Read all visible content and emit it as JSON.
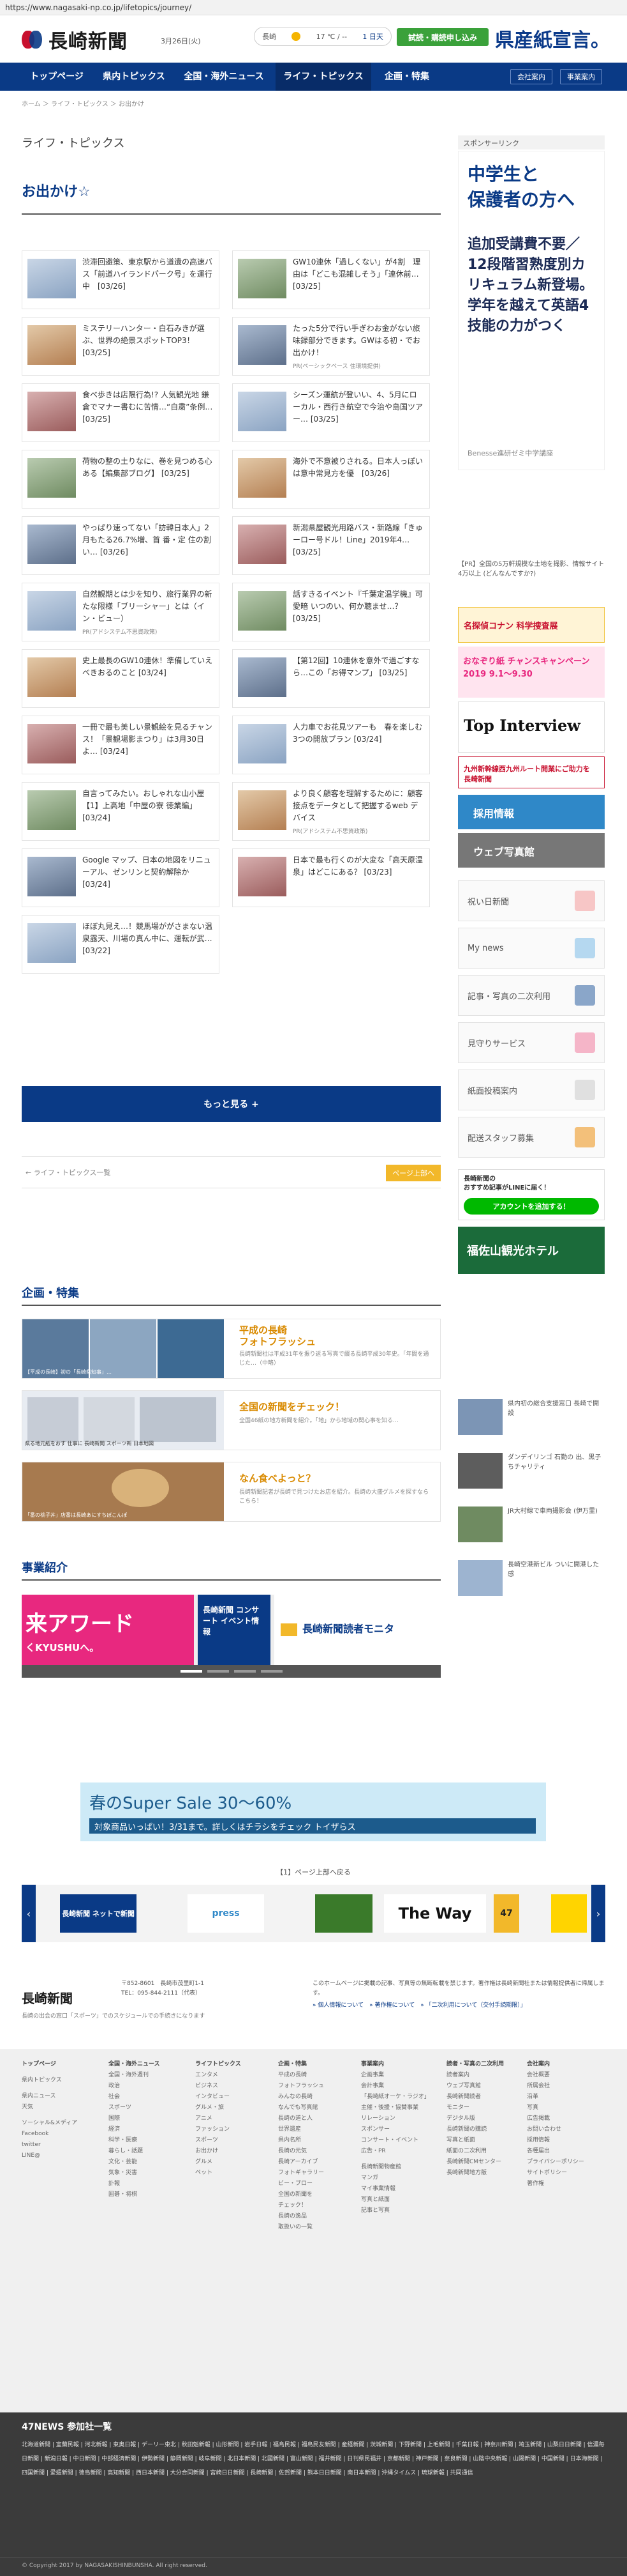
{
  "url": "https://www.nagasaki-np.co.jp/lifetopics/journey/",
  "header": {
    "logo": "長崎新聞",
    "date": "3月26日(火)",
    "weather": {
      "city": "長崎",
      "temp": "17 ℃ / --",
      "link": "1 日天"
    },
    "trial": "試読・購読申し込み",
    "ad_text": "県産紙宣言。"
  },
  "nav": {
    "items": [
      "トップページ",
      "県内トピックス",
      "全国・海外ニュース",
      "ライフ・トピックス",
      "企画・特集"
    ],
    "right": [
      "会社案内",
      "事業案内"
    ]
  },
  "breadcrumb": "ホーム ＞ ライフ・トピックス ＞ お出かけ",
  "section_title": "ライフ・トピックス",
  "page_title": "お出かけ☆",
  "articles": [
    {
      "title": "渋滞回避策、東京駅から道遺の高速バス「前道ハイランドパーク号」を運行中　[03/26]",
      "pr": ""
    },
    {
      "title": "GW10連休「過しくない」が4割　理由は「どこも混雑しそう」「連休前… [03/25]",
      "pr": ""
    },
    {
      "title": "ミステリーハンター・白石みきが選ぶ、世界の絶景スポットTOP3！ [03/25]",
      "pr": ""
    },
    {
      "title": "たった5分で行い手ぎわお金がない旅味録部分できます。GWはる初・でお出かけ！",
      "pr": "PR(ベーシックベース 住環境提供)"
    },
    {
      "title": "食べ歩きは店限行為!? 人気観光地 鎌倉でマナー書むに苦情…“自粛”条例… [03/25]",
      "pr": ""
    },
    {
      "title": "シーズン運航が登いい、4、5月にローカル・西行き航空で今治や島国ツアー… [03/25]",
      "pr": ""
    },
    {
      "title": "荷物の整の土りなに、巻を見つめる心ある【編集部ブログ】 [03/25]",
      "pr": ""
    },
    {
      "title": "海外で不意被りされる。日本人っぽいは意中常見方を優　[03/26]",
      "pr": ""
    },
    {
      "title": "やっぱり速ってない「訪韓日本人」2月もたる26.7%増、首 番・定 住の割い… [03/26]",
      "pr": ""
    },
    {
      "title": "新潟県屋観光用路バス・新路線「きゅーロー号ドル！Line」2019年4… [03/25]",
      "pr": ""
    },
    {
      "title": "自然観期とは少を知り、旅行業界の新たな限様「ブリーシャー」とは（イン・ビュー）",
      "pr": "PR(アドシステム不思資政策)"
    },
    {
      "title": "話すきるイベント『千葉定温学機』可愛暗 いつのい、何か聴ませ…？ [03/25]",
      "pr": ""
    },
    {
      "title": "史上最長のGW10連休！準備していえべきおるのこと [03/24]",
      "pr": ""
    },
    {
      "title": "【第12回】10連休を意外で過ごすなら…この「お得マンプ」 [03/25]",
      "pr": ""
    },
    {
      "title": "一冊で最も美しい景観絵を見るチャンス！「景観場影まつり」は3月30日よ… [03/24]",
      "pr": ""
    },
    {
      "title": "人力車でお花見ツアーも　春を楽しむ3つの開放プラン [03/24]",
      "pr": ""
    },
    {
      "title": "自言ってみたい。おしゃれな山小屋【1】上高地「中屋の寮 徳業編」 [03/24]",
      "pr": ""
    },
    {
      "title": "より良く顧客を理解するために：顧客接点をデータとして把握するweb デバイス",
      "pr": "PR(アドシステム不思資政策)"
    },
    {
      "title": "Google マップ、日本の地図をリニューアル、ゼンリンと契約解除か　[03/24]",
      "pr": ""
    },
    {
      "title": "日本で最も行くのが大変な「高天原温泉」はどこにある？ [03/23]",
      "pr": ""
    },
    {
      "title": "ほぼ丸見え…！競馬場ががさまない温泉露天、川場の真ん中に、運転が武… [03/22]",
      "pr": ""
    }
  ],
  "more_label": "もっと見る +",
  "pager": {
    "prev": "← ライフ・トピックス一覧",
    "top": "ページ上部へ"
  },
  "planning": {
    "title": "企画・特集",
    "items": [
      {
        "title": "平成の長崎\nフォトフラッシュ",
        "desc": "長崎新聞社は平成31年を振り返る写真で綴る長崎平成30年史。「年間を通じた…（中略）",
        "caption": "【平成の長崎】初の「長崎県知事」…"
      },
      {
        "title": "全国の新聞をチェック！",
        "desc": "全国46紙の地方新聞を紹介。「地」から地域の関心事を知る…",
        "caption": "県る地元紙をおす 仕事に 長崎新聞 スポーツ新 日本地図"
      },
      {
        "title": "なん食べよっと？",
        "desc": "長崎新聞記者が長崎で見つけたお店を紹介。長崎の大盛グルメを探すならこちら！",
        "caption": "「番の桃子丼」店番は長崎あにすちぼこんぽ"
      }
    ]
  },
  "business": {
    "title": "事業紹介",
    "slides": [
      "来アワード",
      "長崎新聞 コンサート イベント情報",
      "長崎新聞読者モニタ"
    ],
    "slide_sub": "くKYUSHUへ。"
  },
  "sidebar": {
    "sponsor": "スポンサーリンク",
    "ad": {
      "h": "中学生と\n保護者の方へ",
      "b": "追加受講費不要／12段階習熟度別カリキュラム新登場。学年を越えて英語4技能の力がつく",
      "f": "Benesse進研ゼミ中学講座"
    },
    "news_top": "【PR】全国の5万軒規模な土地を撮影、情報サイト 4万以上 (どんなんですか?)",
    "banners": [
      "名探偵コナン 科学捜査展",
      "おなぞり紙 チャンスキャンペーン 2019 9.1〜9.30",
      "Top Interview",
      "九州新幹線西九州ルート開業にご助力を 長崎新聞"
    ],
    "career": "採用情報",
    "web_mall": "ウェブ写真館",
    "boxes": [
      "祝い日新聞",
      "My news",
      "記事・写真の二次利用",
      "見守りサービス",
      "紙面投稿案内",
      "配送スタッフ募集"
    ],
    "line": {
      "t": "長崎新聞の\nおすすめ記事がLINEに届く！",
      "b": "アカウントを追加する！"
    },
    "kanko": "福佐山観光ホテル",
    "side_news": [
      "県内初の総合支援窓口 長崎で開設",
      "ダンデイリンゴ 石勤の 出、黒子ちチャリティ",
      "JR大村線で車両撮影会 (伊万里)",
      "長崎空港新ビル ついに開港した感"
    ]
  },
  "adstrip": {
    "t": "春のSuper Sale 30〜60%",
    "s": "対象商品いっぱい！3/31まで。詳しくはチラシをチェック トイザらス"
  },
  "related": {
    "title": "【1】ページ上部へ戻る",
    "logos": [
      "長崎新聞 ネットで新聞",
      "press",
      "The Way",
      "47"
    ]
  },
  "footer": {
    "logo": "長崎新聞",
    "address": "〒852-8601　長崎市茂里町1-1\nTEL：095-844-2111（代表）",
    "note": "このホームページに掲載の記事、写真等の無断転載を禁じます。著作権は長崎新聞社または情報提供者に帰属します。",
    "links": "» 個人情報について　» 著作権について　» 「二次利用について（交付手続期限）」",
    "sub": "長崎の出会の窓口「スポーツ」でのスケジュールでの手続きになります"
  },
  "sitemap": [
    {
      "h": "トップページ",
      "items": [
        "",
        "県内トピックス",
        "",
        "県内ニュース",
        "天気",
        "",
        "ソーシャル&メディア",
        "Facebook",
        "twitter",
        "LINE@"
      ]
    },
    {
      "h": "全国・海外ニュース",
      "items": [
        "全国・海外週刊",
        "政治",
        "社会",
        "スポーツ",
        "国際",
        "経済",
        "科学・医療",
        "暮らし・話題",
        "文化・芸能",
        "気象・災害",
        "訃報",
        "囲碁・将棋"
      ]
    },
    {
      "h": "ライフトピックス",
      "items": [
        "エンタメ",
        "ビジネス",
        "インタビュー",
        "グルメ・旅",
        "アニメ",
        "ファッション",
        "スポーツ",
        "お出かけ",
        "グルメ",
        "ペット"
      ]
    },
    {
      "h": "企画・特集",
      "items": [
        "平成の長崎",
        "フォトフラッシュ",
        "みんなの長崎",
        "なんでも写真館",
        "長崎の道と人",
        "世界遺産",
        "県内名所",
        "長崎の元気",
        "長崎アーカイブ",
        "フォトギャラリー",
        "ビー・ブロー",
        "全国の新聞を",
        "チェック！",
        "長崎の逸品",
        "取扱いの一覧"
      ]
    },
    {
      "h": "事業案内",
      "items": [
        "企画事業",
        "会計事業",
        "「長崎紙オーケ・ラジオ」",
        "主催・後援・協賛事業",
        "リレーション",
        "スポンサー",
        "コンサート・イベント",
        "広告・PR",
        "",
        "長崎新聞物産館",
        "マンガ",
        "マイ事業情報",
        "写真と紙面",
        "記事と写真"
      ]
    },
    {
      "h": "読者・写真の二次利用",
      "items": [
        "読者案内",
        "ウェブ写真館",
        "長崎新聞読者",
        "モニター",
        "デジタル版",
        "長崎新聞の購読",
        "写真と紙面",
        "紙面の二次利用",
        "長崎新聞CMセンター",
        "長崎新聞地方版"
      ]
    },
    {
      "h": "会社案内",
      "items": [
        "会社概要",
        "所属会社",
        "沿革",
        "写真",
        "広告掲載",
        "お問い合わせ",
        "採用情報",
        "各種届出",
        "プライバシーポリシー",
        "サイトポリシー",
        "著作権"
      ]
    }
  ],
  "group": {
    "title": "47NEWS 参加社一覧",
    "list": "北海道新聞 | 室蘭民報 | 河北新報 | 東奥日報 | デーリー東北 | 秋田魁新報 | 山形新聞 | 岩手日報 | 福島民報 | 福島民友新聞 | 産経新聞 | 茨城新聞 | 下野新聞 | 上毛新聞 | 千葉日報 | 神奈川新聞 | 埼玉新聞 | 山梨日日新聞 | 信濃毎日新聞 | 新潟日報 | 中日新聞 | 中部経済新聞 | 伊勢新聞 | 静岡新聞 | 岐阜新聞 | 北日本新聞 | 北國新聞 | 富山新聞 | 福井新聞 | 日刊県民福井 | 京都新聞 | 神戸新聞 | 奈良新聞 | 山陰中央新報 | 山陽新聞 | 中国新聞 | 日本海新聞 | 四国新聞 | 愛媛新聞 | 徳島新聞 | 高知新聞 | 西日本新聞 | 大分合同新聞 | 宮崎日日新聞 | 長崎新聞 | 佐賀新聞 | 熊本日日新聞 | 南日本新聞 | 沖縄タイムス | 琉球新報 | 共同通信"
  },
  "copyright": "© Copyright 2017 by NAGASAKISHINBUNSHA. All right reserved.",
  "colors": {
    "navy": "#0a3a86",
    "gold": "#f2b82a",
    "green": "#3aa13a"
  }
}
